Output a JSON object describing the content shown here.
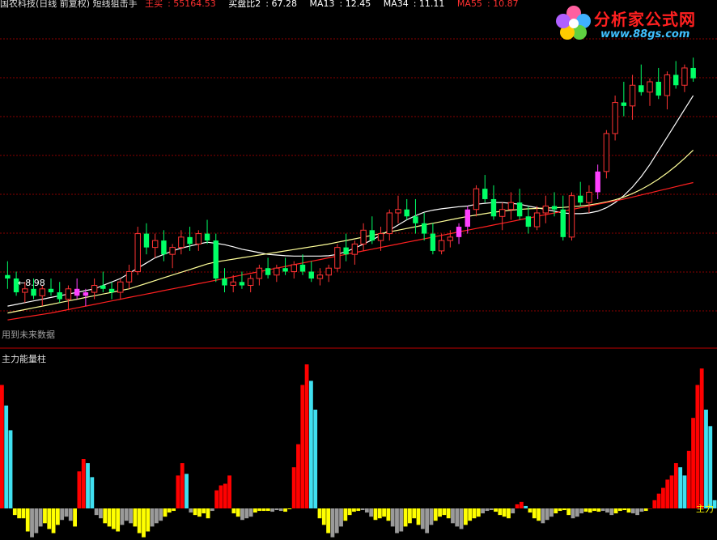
{
  "header": {
    "title": "国农科技(日线 前复权) 短线狙击手",
    "indicators": [
      {
        "name": "王买",
        "value": "55164.53",
        "color": "#ff3030"
      },
      {
        "name": "买盘比2",
        "value": "67.28",
        "color": "#ffffff"
      },
      {
        "name": "MA13",
        "value": "12.45",
        "color": "#ffffff"
      },
      {
        "name": "MA34",
        "value": "11.11",
        "color": "#ffffff"
      },
      {
        "name": "MA55",
        "value": "10.87",
        "color": "#ff3030"
      }
    ]
  },
  "logo": {
    "name": "分析家公式网",
    "url": "www.88gs.com"
  },
  "price_panel": {
    "low_marker": "8.98",
    "future_data_note": "用到未来数据"
  },
  "volume_panel": {
    "title": "主力能量柱",
    "right_label": "主力"
  },
  "colors": {
    "up": "#ff3333",
    "down": "#00ff66",
    "highlight": "#ff40ff",
    "ma13": "#ffffff",
    "ma34": "#ffff99",
    "ma55": "#ff2020",
    "bar_red": "#ff0000",
    "bar_cyan": "#40e0f0",
    "bar_yellow": "#ffff00",
    "bar_gray": "#9a9a9a",
    "grid": "#8a0000"
  },
  "chart_data": [
    {
      "type": "candlestick",
      "title": "国农科技(日线 前复权)",
      "ylim": [
        8.0,
        17.5
      ],
      "candles": [
        [
          10.0,
          10.4,
          9.6,
          9.9
        ],
        [
          9.9,
          10.1,
          9.4,
          9.5
        ],
        [
          9.5,
          9.8,
          9.2,
          9.6
        ],
        [
          9.6,
          9.9,
          9.3,
          9.4
        ],
        [
          9.4,
          9.7,
          9.1,
          9.6
        ],
        [
          9.6,
          9.9,
          9.4,
          9.5
        ],
        [
          9.5,
          9.8,
          9.2,
          9.3
        ],
        [
          9.3,
          9.7,
          9.0,
          9.6
        ],
        [
          9.6,
          9.9,
          9.3,
          9.4
        ],
        [
          9.4,
          9.6,
          9.1,
          9.5
        ],
        [
          9.5,
          9.9,
          9.3,
          9.7
        ],
        [
          9.7,
          10.1,
          9.5,
          9.6
        ],
        [
          9.6,
          9.8,
          9.3,
          9.5
        ],
        [
          9.5,
          9.9,
          9.3,
          9.8
        ],
        [
          9.8,
          10.3,
          9.6,
          10.1
        ],
        [
          10.1,
          11.4,
          10.0,
          11.2
        ],
        [
          11.2,
          11.5,
          10.6,
          10.8
        ],
        [
          10.8,
          11.2,
          10.5,
          11.0
        ],
        [
          11.0,
          11.3,
          10.4,
          10.6
        ],
        [
          10.6,
          10.9,
          10.2,
          10.8
        ],
        [
          10.8,
          11.3,
          10.6,
          11.1
        ],
        [
          11.1,
          11.4,
          10.7,
          10.9
        ],
        [
          10.9,
          11.3,
          10.7,
          11.2
        ],
        [
          11.2,
          11.6,
          10.9,
          11.0
        ],
        [
          11.0,
          11.2,
          9.8,
          9.9
        ],
        [
          9.9,
          10.2,
          9.5,
          9.7
        ],
        [
          9.7,
          10.0,
          9.5,
          9.8
        ],
        [
          9.8,
          10.1,
          9.6,
          9.7
        ],
        [
          9.7,
          10.0,
          9.5,
          9.9
        ],
        [
          9.9,
          10.3,
          9.7,
          10.2
        ],
        [
          10.2,
          10.5,
          9.9,
          10.0
        ],
        [
          10.0,
          10.3,
          9.8,
          10.2
        ],
        [
          10.2,
          10.5,
          10.0,
          10.1
        ],
        [
          10.1,
          10.4,
          9.9,
          10.3
        ],
        [
          10.3,
          10.6,
          10.0,
          10.1
        ],
        [
          10.1,
          10.4,
          9.8,
          9.9
        ],
        [
          9.9,
          10.2,
          9.7,
          10.0
        ],
        [
          10.0,
          10.3,
          9.8,
          10.2
        ],
        [
          10.2,
          10.9,
          10.1,
          10.8
        ],
        [
          10.8,
          11.2,
          10.4,
          10.6
        ],
        [
          10.6,
          11.0,
          10.3,
          10.9
        ],
        [
          10.9,
          11.5,
          10.7,
          11.3
        ],
        [
          11.3,
          11.7,
          10.9,
          11.0
        ],
        [
          11.0,
          11.4,
          10.7,
          11.2
        ],
        [
          11.2,
          11.9,
          11.0,
          11.8
        ],
        [
          11.8,
          12.3,
          11.5,
          11.9
        ],
        [
          11.9,
          12.2,
          11.6,
          11.7
        ],
        [
          11.7,
          12.2,
          11.2,
          11.5
        ],
        [
          11.5,
          11.8,
          11.0,
          11.2
        ],
        [
          11.2,
          11.5,
          10.6,
          10.7
        ],
        [
          10.7,
          11.2,
          10.6,
          11.0
        ],
        [
          11.0,
          11.3,
          10.8,
          11.1
        ],
        [
          11.1,
          11.5,
          10.9,
          11.4
        ],
        [
          11.4,
          12.0,
          11.2,
          11.9
        ],
        [
          11.9,
          12.6,
          11.7,
          12.5
        ],
        [
          12.5,
          12.9,
          12.1,
          12.2
        ],
        [
          12.2,
          12.6,
          11.6,
          11.7
        ],
        [
          11.7,
          12.1,
          11.3,
          11.9
        ],
        [
          11.9,
          12.4,
          11.6,
          12.1
        ],
        [
          12.1,
          12.5,
          11.6,
          11.7
        ],
        [
          11.7,
          12.0,
          11.2,
          11.4
        ],
        [
          11.4,
          12.0,
          11.3,
          11.8
        ],
        [
          11.8,
          12.3,
          11.5,
          12.0
        ],
        [
          12.0,
          12.4,
          11.7,
          11.9
        ],
        [
          11.9,
          12.3,
          11.0,
          11.1
        ],
        [
          11.1,
          12.4,
          11.0,
          12.3
        ],
        [
          12.3,
          12.7,
          12.0,
          12.1
        ],
        [
          12.1,
          12.6,
          11.8,
          12.4
        ],
        [
          12.4,
          13.2,
          12.2,
          13.0
        ],
        [
          13.0,
          14.2,
          12.8,
          14.1
        ],
        [
          14.1,
          15.2,
          13.9,
          15.0
        ],
        [
          15.0,
          15.6,
          14.6,
          14.9
        ],
        [
          14.9,
          15.8,
          14.5,
          15.5
        ],
        [
          15.5,
          16.1,
          15.2,
          15.3
        ],
        [
          15.3,
          15.7,
          14.9,
          15.6
        ],
        [
          15.6,
          16.0,
          15.1,
          15.2
        ],
        [
          15.2,
          15.9,
          14.8,
          15.8
        ],
        [
          15.8,
          16.2,
          15.4,
          15.5
        ],
        [
          15.5,
          16.1,
          15.3,
          16.0
        ],
        [
          16.0,
          16.3,
          15.6,
          15.7
        ]
      ],
      "series": [
        {
          "name": "MA13",
          "values": [
            9.1,
            9.15,
            9.2,
            9.25,
            9.3,
            9.35,
            9.4,
            9.45,
            9.5,
            9.55,
            9.6,
            9.7,
            9.8,
            9.9,
            10.05,
            10.2,
            10.35,
            10.5,
            10.6,
            10.7,
            10.78,
            10.84,
            10.9,
            10.95,
            10.92,
            10.88,
            10.82,
            10.75,
            10.7,
            10.65,
            10.6,
            10.58,
            10.56,
            10.55,
            10.55,
            10.55,
            10.55,
            10.56,
            10.6,
            10.68,
            10.78,
            10.9,
            11.02,
            11.15,
            11.3,
            11.45,
            11.6,
            11.72,
            11.82,
            11.88,
            11.92,
            11.95,
            11.98,
            12.0,
            12.05,
            12.08,
            12.1,
            12.1,
            12.08,
            12.05,
            12.0,
            11.95,
            11.9,
            11.85,
            11.8,
            11.78,
            11.78,
            11.8,
            11.85,
            11.95,
            12.1,
            12.3,
            12.55,
            12.85,
            13.2,
            13.6,
            14.0,
            14.4,
            14.8,
            15.2
          ]
        },
        {
          "name": "MA34",
          "values": [
            8.9,
            8.95,
            9.0,
            9.05,
            9.1,
            9.15,
            9.2,
            9.25,
            9.3,
            9.35,
            9.4,
            9.45,
            9.5,
            9.55,
            9.6,
            9.68,
            9.76,
            9.84,
            9.92,
            10.0,
            10.08,
            10.16,
            10.24,
            10.32,
            10.38,
            10.42,
            10.46,
            10.5,
            10.54,
            10.58,
            10.62,
            10.66,
            10.7,
            10.74,
            10.78,
            10.82,
            10.86,
            10.9,
            10.95,
            11.0,
            11.05,
            11.1,
            11.15,
            11.2,
            11.25,
            11.3,
            11.35,
            11.4,
            11.45,
            11.5,
            11.55,
            11.6,
            11.65,
            11.7,
            11.74,
            11.78,
            11.82,
            11.85,
            11.88,
            11.9,
            11.92,
            11.93,
            11.94,
            11.95,
            11.96,
            11.98,
            12.0,
            12.03,
            12.07,
            12.12,
            12.18,
            12.26,
            12.36,
            12.48,
            12.62,
            12.78,
            12.96,
            13.16,
            13.38,
            13.62
          ]
        },
        {
          "name": "MA55",
          "values": [
            8.7,
            8.74,
            8.78,
            8.82,
            8.86,
            8.9,
            8.95,
            9.0,
            9.05,
            9.1,
            9.15,
            9.2,
            9.25,
            9.3,
            9.35,
            9.4,
            9.45,
            9.5,
            9.55,
            9.6,
            9.65,
            9.7,
            9.75,
            9.8,
            9.85,
            9.9,
            9.95,
            10.0,
            10.05,
            10.1,
            10.15,
            10.2,
            10.25,
            10.3,
            10.35,
            10.4,
            10.45,
            10.5,
            10.55,
            10.6,
            10.65,
            10.7,
            10.75,
            10.8,
            10.85,
            10.9,
            10.95,
            11.0,
            11.05,
            11.1,
            11.15,
            11.2,
            11.25,
            11.3,
            11.35,
            11.4,
            11.45,
            11.5,
            11.55,
            11.6,
            11.65,
            11.7,
            11.75,
            11.8,
            11.85,
            11.9,
            11.95,
            12.0,
            12.05,
            12.1,
            12.15,
            12.2,
            12.26,
            12.32,
            12.38,
            12.44,
            12.5,
            12.56,
            12.62,
            12.68
          ]
        }
      ],
      "highlight_indices": [
        8,
        9,
        52,
        53,
        68
      ]
    },
    {
      "type": "bar",
      "title": "主力能量柱",
      "ylim": [
        -40,
        180
      ],
      "values": [
        150,
        125,
        95,
        -8,
        -12,
        -12,
        -28,
        -35,
        -30,
        -22,
        -18,
        -25,
        -30,
        -20,
        -14,
        -10,
        -15,
        -22,
        45,
        60,
        55,
        38,
        -8,
        -12,
        -18,
        -22,
        -25,
        -28,
        -20,
        -15,
        -18,
        -22,
        -30,
        -35,
        -28,
        -22,
        -18,
        -15,
        -10,
        -5,
        -3,
        40,
        55,
        42,
        -5,
        -8,
        -10,
        -6,
        -12,
        -3,
        22,
        28,
        30,
        40,
        -6,
        -10,
        -14,
        -12,
        -10,
        -5,
        -3,
        -3,
        -3,
        -4,
        -2,
        -3,
        -4,
        -1,
        50,
        78,
        150,
        175,
        155,
        120,
        -12,
        -20,
        -30,
        -35,
        -30,
        -22,
        -15,
        -8,
        -4,
        -3,
        -2,
        -5,
        -10,
        -14,
        -12,
        -10,
        -15,
        -22,
        -30,
        -28,
        -22,
        -18,
        -12,
        -20,
        -25,
        -30,
        -20,
        -15,
        -10,
        -8,
        -12,
        -18,
        -22,
        -25,
        -20,
        -15,
        -12,
        -10,
        -6,
        -3,
        -2,
        -4,
        -8,
        -10,
        -12,
        -6,
        5,
        8,
        3,
        -5,
        -12,
        -15,
        -18,
        -14,
        -10,
        -6,
        -3,
        -2,
        -8,
        -12,
        -10,
        -6,
        -4,
        -5,
        -3,
        -4,
        -3,
        -5,
        -8,
        -6,
        -3,
        -2,
        -5,
        -6,
        -8,
        -4,
        -3,
        0,
        10,
        18,
        25,
        35,
        40,
        55,
        50,
        40,
        70,
        110,
        150,
        170,
        120,
        100,
        10
      ],
      "colors_seq": "see script"
    }
  ]
}
